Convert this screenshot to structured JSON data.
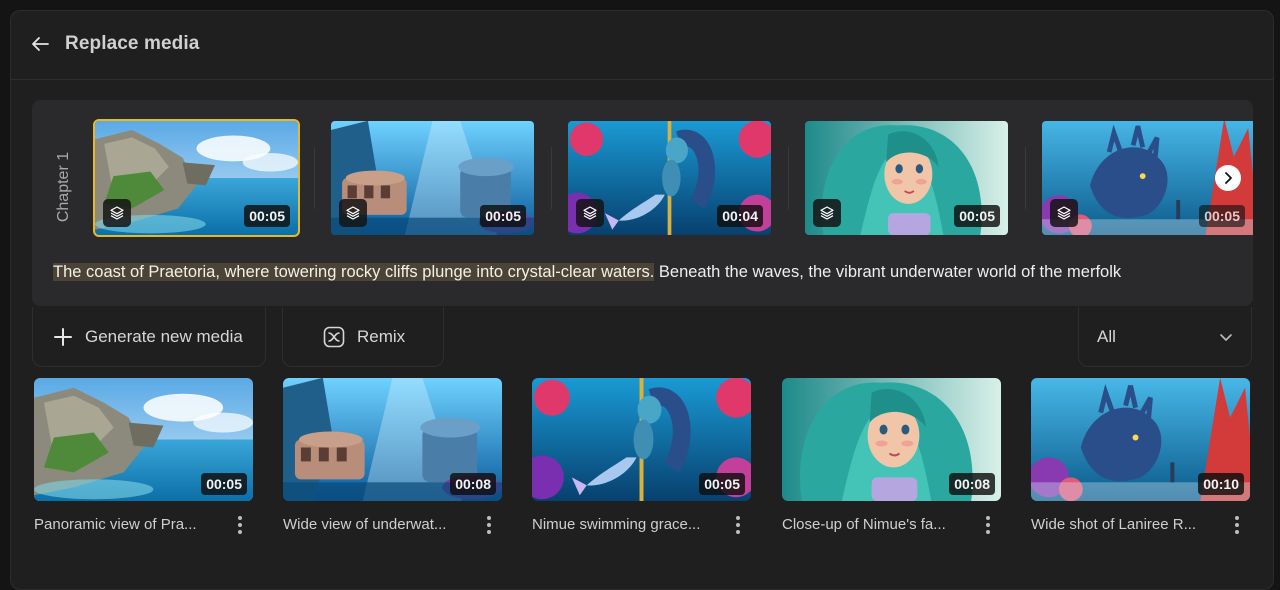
{
  "header": {
    "title": "Replace media"
  },
  "chapter": {
    "label": "Chapter 1",
    "scenes": [
      {
        "duration": "00:05",
        "theme": "coast",
        "selected": true
      },
      {
        "duration": "00:05",
        "theme": "city",
        "selected": false
      },
      {
        "duration": "00:04",
        "theme": "mermaid-swim",
        "selected": false
      },
      {
        "duration": "00:05",
        "theme": "mermaid-face",
        "selected": false
      },
      {
        "duration": "00:05",
        "theme": "creature",
        "selected": false
      }
    ],
    "script_highlight": "The coast of Praetoria, where towering rocky cliffs plunge into crystal-clear waters.",
    "script_rest": " Beneath the waves, the vibrant underwater world of the merfolk"
  },
  "toolbar": {
    "generate_label": "Generate new media",
    "remix_label": "Remix",
    "filter_value": "All"
  },
  "media": [
    {
      "caption": "Panoramic view of Pra...",
      "duration": "00:05",
      "theme": "coast"
    },
    {
      "caption": "Wide view of underwat...",
      "duration": "00:08",
      "theme": "city"
    },
    {
      "caption": "Nimue swimming grace...",
      "duration": "00:05",
      "theme": "mermaid-swim"
    },
    {
      "caption": "Close-up of Nimue's fa...",
      "duration": "00:08",
      "theme": "mermaid-face"
    },
    {
      "caption": "Wide shot of Laniree R...",
      "duration": "00:10",
      "theme": "creature"
    }
  ],
  "colors": {
    "selected_outline": "#e8b923",
    "highlight_bg": "#4b4336",
    "panel_bg": "#1f1f20",
    "card_bg": "#2a2a2c"
  },
  "icons": [
    "back-arrow-icon",
    "layers-icon",
    "chevron-right-icon",
    "plus-icon",
    "remix-icon",
    "chevron-down-icon",
    "more-vertical-icon"
  ]
}
